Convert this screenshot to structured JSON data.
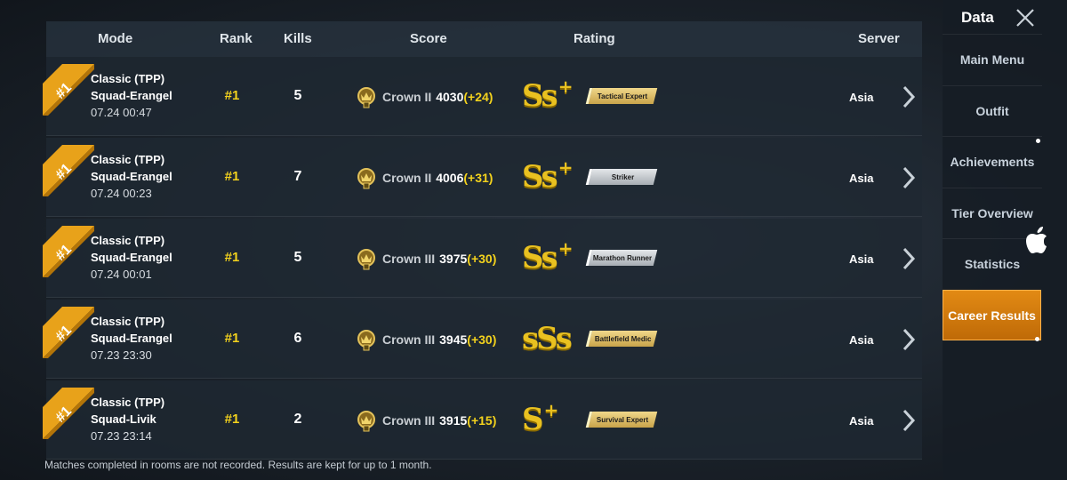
{
  "header": {
    "mode": "Mode",
    "rank": "Rank",
    "kills": "Kills",
    "score": "Score",
    "rating": "Rating",
    "server": "Server"
  },
  "matches": [
    {
      "ribbon": "#1",
      "mode": "Classic (TPP)",
      "map": "Squad-Erangel",
      "date": "07.24 00:47",
      "rank": "#1",
      "kills": "5",
      "tier": "Crown II",
      "score": "4030",
      "delta": "(+24)",
      "grade": "Ss",
      "grade_plus": "+",
      "badge": "Tactical Expert",
      "badge_style": "gold",
      "server": "Asia"
    },
    {
      "ribbon": "#1",
      "mode": "Classic (TPP)",
      "map": "Squad-Erangel",
      "date": "07.24 00:23",
      "rank": "#1",
      "kills": "7",
      "tier": "Crown II",
      "score": "4006",
      "delta": "(+31)",
      "grade": "Ss",
      "grade_plus": "+",
      "badge": "Striker",
      "badge_style": "silver",
      "server": "Asia"
    },
    {
      "ribbon": "#1",
      "mode": "Classic (TPP)",
      "map": "Squad-Erangel",
      "date": "07.24 00:01",
      "rank": "#1",
      "kills": "5",
      "tier": "Crown III",
      "score": "3975",
      "delta": "(+30)",
      "grade": "Ss",
      "grade_plus": "+",
      "badge": "Marathon Runner",
      "badge_style": "silver",
      "server": "Asia"
    },
    {
      "ribbon": "#1",
      "mode": "Classic (TPP)",
      "map": "Squad-Erangel",
      "date": "07.23 23:30",
      "rank": "#1",
      "kills": "6",
      "tier": "Crown III",
      "score": "3945",
      "delta": "(+30)",
      "grade": "sSs",
      "grade_plus": "",
      "badge": "Battlefield Medic",
      "badge_style": "gold",
      "server": "Asia"
    },
    {
      "ribbon": "#1",
      "mode": "Classic (TPP)",
      "map": "Squad-Livik",
      "date": "07.23 23:14",
      "rank": "#1",
      "kills": "2",
      "tier": "Crown III",
      "score": "3915",
      "delta": "(+15)",
      "grade": "S",
      "grade_plus": "+",
      "badge": "Survival Expert",
      "badge_style": "gold",
      "server": "Asia"
    }
  ],
  "footnote": "Matches completed in rooms are not recorded. Results are kept for up to 1 month.",
  "sidebar": {
    "title": "Data",
    "items": [
      {
        "label": "Main Menu",
        "active": false
      },
      {
        "label": "Outfit",
        "active": false
      },
      {
        "label": "Achievements",
        "active": false
      },
      {
        "label": "Tier Overview",
        "active": false
      },
      {
        "label": "Statistics",
        "active": false
      },
      {
        "label": "Career Results",
        "active": true
      }
    ]
  },
  "colors": {
    "accent": "#d97e10",
    "rank_yellow": "#f3d21d",
    "grade_gold": "#e9c120"
  }
}
